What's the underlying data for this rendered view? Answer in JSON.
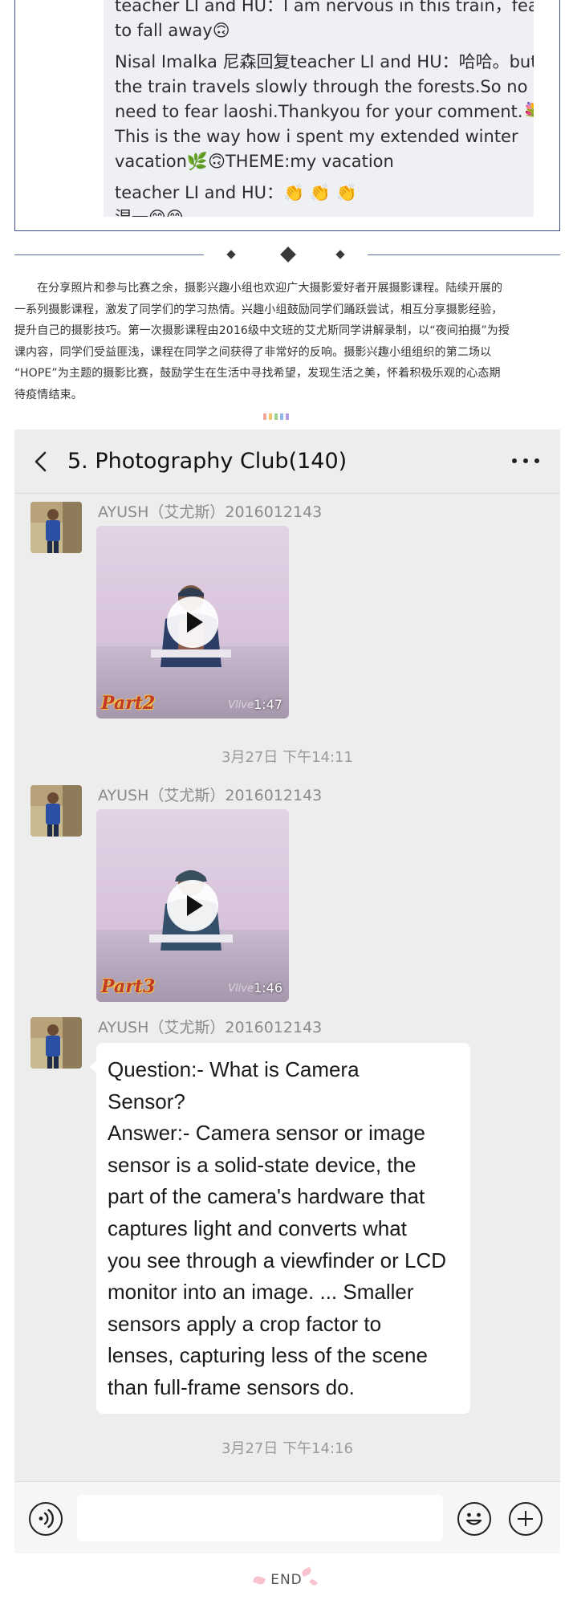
{
  "comment_card": {
    "lines": [
      "teacher LI and HU：I am nervous in this train，fear",
      "to fall away🙃",
      "Nisal Imalka 尼森回复teacher LI and HU：哈哈。but",
      "the train travels slowly through the forests.So no",
      "need to fear laoshi.Thankyou for your comment.💐",
      "This is the way how i spent my extended winter",
      "vacation🌿🙃THEME:my vacation",
      "teacher LI and HU：👏 👏 👏",
      "湿一😊😊"
    ]
  },
  "article": {
    "paragraph_lines": [
      "在分享照片和参与比赛之余，摄影兴趣小组也欢迎广大摄影爱好者开展摄影课程。陆续开展的",
      "一系列摄影课程，激发了同学们的学习热情。兴趣小组鼓励同学们踊跃尝试，相互分享摄影经验，",
      "提升自己的摄影技巧。第一次摄影课程由2016级中文班的艾尤斯同学讲解录制，以“夜间拍摄”为授",
      "课内容，同学们受益匪浅，课程在同学之间获得了非常好的反响。摄影兴趣小组组织的第二场以",
      "“HOPE”为主题的摄影比赛，鼓励学生在生活中寻找希望，发现生活之美，怀着积极乐观的心态期",
      "待疫情结束。"
    ],
    "colorbar_colors": [
      "#f3a6a0",
      "#f6c26b",
      "#9fd28f",
      "#8fb8e8",
      "#b79be3"
    ]
  },
  "chat": {
    "title": "5. Photography Club(140)",
    "icons": {
      "back": "chevron-left-icon",
      "more": "more-dots-icon",
      "voice": "voice-icon",
      "emoji": "emoji-icon",
      "plus": "plus-icon",
      "play": "play-icon"
    },
    "messages": [
      {
        "sender": "AYUSH（艾尤斯）2016012143",
        "type": "video",
        "part_label": "Part2",
        "duration": "1:47",
        "watermark": "Vlive"
      },
      {
        "sender": "AYUSH（艾尤斯）2016012143",
        "type": "video",
        "part_label": "Part3",
        "duration": "1:46",
        "watermark": "Vlive"
      },
      {
        "sender": "AYUSH（艾尤斯）2016012143",
        "type": "text",
        "lines": [
          "Question:- What is Camera",
          "Sensor?",
          "Answer:- Camera sensor or image",
          "sensor  is a solid-state device, the",
          "part of the camera's hardware that",
          "captures light and converts what",
          "you see through a viewfinder or LCD",
          "monitor into an image. ... Smaller",
          "sensors apply a crop factor to",
          "lenses, capturing less of the scene",
          "than full-frame sensors do."
        ]
      }
    ],
    "timestamps": [
      "3月27日 下午14:11",
      "3月27日 下午14:16"
    ],
    "input_placeholder": ""
  },
  "footer": {
    "end_label": "END"
  },
  "colors": {
    "frame_border": "#3e4b8c",
    "chat_bg": "#ededed",
    "bubble_bg": "#ffffff",
    "timestamp": "#9a9a9a",
    "sender": "#8a8a8a"
  }
}
